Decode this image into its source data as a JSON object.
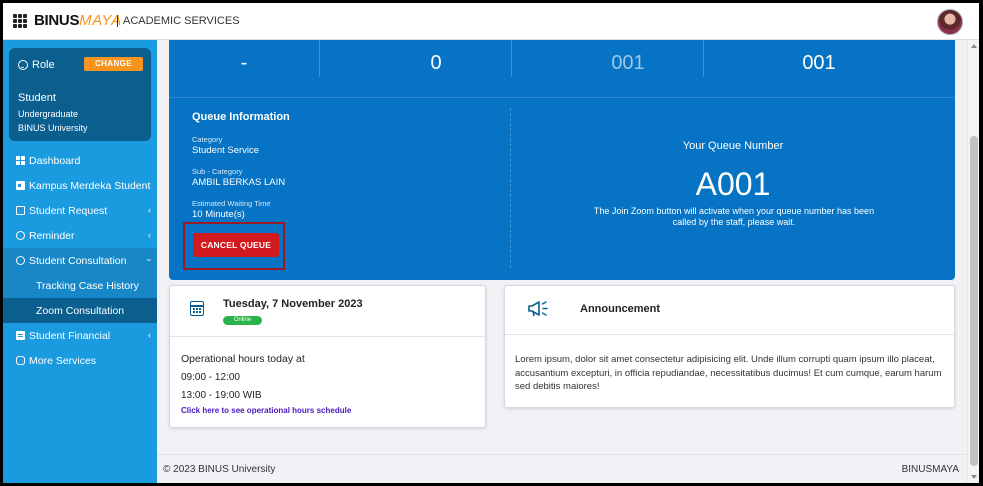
{
  "header": {
    "logo_main": "BINUS",
    "logo_accent": "MAYA",
    "app_name": "ACADEMIC SERVICES"
  },
  "sidebar": {
    "role": {
      "label": "Role",
      "change_label": "CHANGE",
      "name": "Student",
      "line1": "Undergraduate",
      "line2": "BINUS University"
    },
    "items": [
      {
        "label": "Dashboard",
        "icon": "dashboard-icon"
      },
      {
        "label": "Kampus Merdeka Student",
        "icon": "card-icon"
      },
      {
        "label": "Student Request",
        "icon": "list-icon",
        "chevron": "‹"
      },
      {
        "label": "Reminder",
        "icon": "clock-icon",
        "chevron": "‹"
      },
      {
        "label": "Student Consultation",
        "icon": "clock-icon",
        "chevron": "›"
      },
      {
        "label": "Student Financial",
        "icon": "document-icon",
        "chevron": "‹"
      },
      {
        "label": "More Services",
        "icon": "more-icon"
      }
    ],
    "sub_items": [
      {
        "label": "Tracking Case History"
      },
      {
        "label": "Zoom Consultation"
      }
    ]
  },
  "queue_stats": [
    "-",
    "0",
    "001",
    "001"
  ],
  "queue_info": {
    "title": "Queue Information",
    "category_label": "Category",
    "category_value": "Student Service",
    "subcategory_label": "Sub - Category",
    "subcategory_value": "AMBIL BERKAS LAIN",
    "wait_label": "Estimated Waiting Time",
    "wait_value": "10 Minute(s)",
    "cancel_label": "CANCEL QUEUE"
  },
  "your_queue": {
    "label": "Your Queue Number",
    "number": "A001",
    "note": "The Join Zoom button will activate when your queue number has been called by the staff, please wait."
  },
  "hours_card": {
    "date": "Tuesday, 7 November 2023",
    "status": "Online",
    "title": "Operational hours today at",
    "slot1": "09:00 - 12:00",
    "slot2": "13:00 - 19:00 WIB",
    "link": "Click here to see operational hours schedule"
  },
  "announcement": {
    "title": "Announcement",
    "text": "Lorem ipsum, dolor sit amet consectetur adipisicing elit. Unde illum corrupti quam ipsum illo placeat, accusantium excepturi, in officia repudiandae, necessitatibus ducimus! Et cum cumque, earum harum sed debitis maiores!"
  },
  "footer": {
    "copyright": "© 2023 BINUS University",
    "brand": "BINUSMAYA"
  },
  "colors": {
    "primary_blue": "#0673c4",
    "sidebar_blue": "#1a9be0",
    "accent_orange": "#f7941d",
    "danger_red": "#d31920",
    "success_green": "#2bb34b"
  }
}
